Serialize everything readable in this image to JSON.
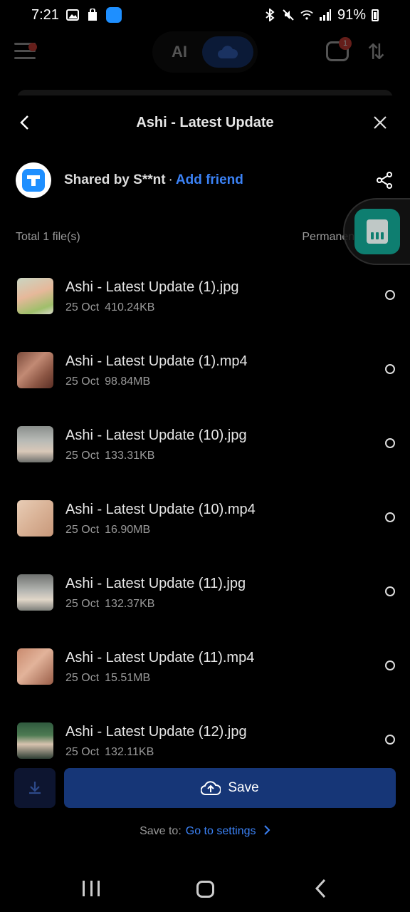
{
  "status_bar": {
    "time": "7:21",
    "battery": "91%"
  },
  "colors": {
    "accent": "#3b82f6",
    "save_button": "#163677",
    "background": "#000000"
  },
  "sheet": {
    "title": "Ashi - Latest Update",
    "shared_by": "Shared by S**nt",
    "separator": "·",
    "add_friend": "Add friend",
    "total_files": "Total 1 file(s)",
    "validity": "Permanent validity"
  },
  "app_bar": {
    "ai_label": "AI",
    "chat_badge": "1"
  },
  "files": [
    {
      "name": "Ashi - Latest Update (1).jpg",
      "date": "25 Oct",
      "size": "410.24KB",
      "thumb_icon": "photo-thumbnail"
    },
    {
      "name": "Ashi - Latest Update (1).mp4",
      "date": "25 Oct",
      "size": "98.84MB",
      "thumb_icon": "video-thumbnail"
    },
    {
      "name": "Ashi - Latest Update (10).jpg",
      "date": "25 Oct",
      "size": "133.31KB",
      "thumb_icon": "photo-thumbnail"
    },
    {
      "name": "Ashi - Latest Update (10).mp4",
      "date": "25 Oct",
      "size": "16.90MB",
      "thumb_icon": "video-thumbnail"
    },
    {
      "name": "Ashi - Latest Update (11).jpg",
      "date": "25 Oct",
      "size": "132.37KB",
      "thumb_icon": "photo-thumbnail"
    },
    {
      "name": "Ashi - Latest Update (11).mp4",
      "date": "25 Oct",
      "size": "15.51MB",
      "thumb_icon": "video-thumbnail"
    },
    {
      "name": "Ashi - Latest Update (12).jpg",
      "date": "25 Oct",
      "size": "132.11KB",
      "thumb_icon": "photo-thumbnail"
    }
  ],
  "actions": {
    "save_label": "Save",
    "save_to_label": "Save to:",
    "go_to_settings": "Go to settings"
  }
}
